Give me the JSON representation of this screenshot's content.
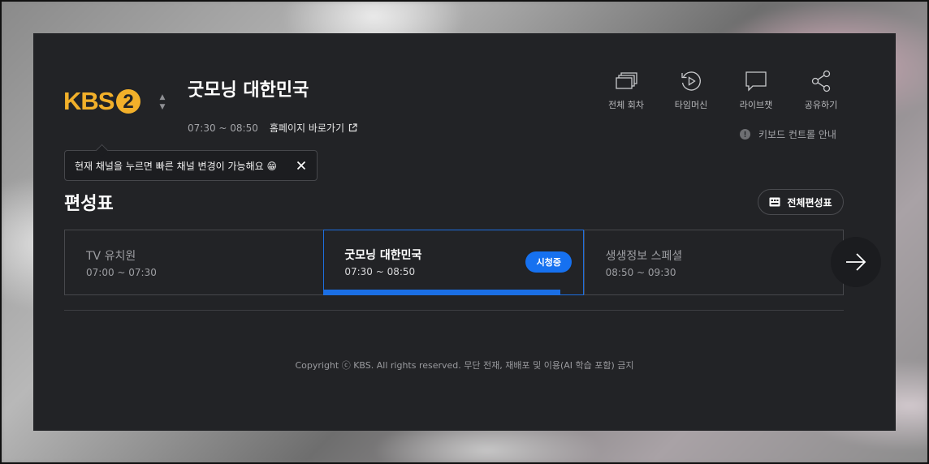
{
  "channel": {
    "logo_text": "KBS",
    "logo_numeral": "2"
  },
  "program": {
    "title": "굿모닝 대한민국",
    "air_time": "07:30 ~ 08:50",
    "homepage_label": "홈페이지 바로가기"
  },
  "tooltip": {
    "text": "현재 채널을 누르면 빠른 채널 변경이 가능해요 😁"
  },
  "actions": [
    {
      "label": "전체 회차",
      "icon": "episodes-icon"
    },
    {
      "label": "타임머신",
      "icon": "timemachine-icon"
    },
    {
      "label": "라이브챗",
      "icon": "chat-icon"
    },
    {
      "label": "공유하기",
      "icon": "share-icon"
    }
  ],
  "keyboard_guide": {
    "label": "키보드 컨트롤 안내"
  },
  "schedule": {
    "heading": "편성표",
    "full_schedule_label": "전체편성표",
    "items": [
      {
        "title": "TV 유치원",
        "time": "07:00 ~ 07:30"
      },
      {
        "title": "굿모닝 대한민국",
        "time": "07:30 ~ 08:50",
        "badge": "시청중",
        "progress_percent": 91
      },
      {
        "title": "생생정보 스페셜",
        "time": "08:50 ~ 09:30"
      }
    ]
  },
  "footer": {
    "copyright": "Copyright ⓒ KBS. All rights reserved. 무단 전재, 재배포 및 이용(AI 학습 포함) 금지"
  },
  "colors": {
    "accent": "#1671f0",
    "logo": "#f2b02a",
    "modal_bg": "#222326"
  }
}
